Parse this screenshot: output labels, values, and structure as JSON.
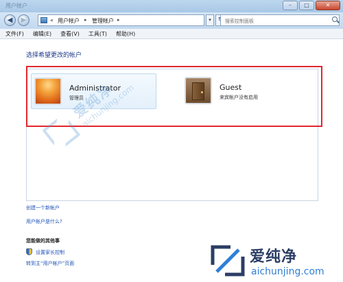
{
  "window": {
    "title": "用户帐户",
    "minimize_glyph": "–",
    "maximize_glyph": "□",
    "close_glyph": "✕"
  },
  "navigation": {
    "back_glyph": "◀",
    "forward_glyph": "▶",
    "address_icon": "control-panel-icon",
    "address_chevron": "«",
    "breadcrumbs": [
      {
        "label": "用户帐户"
      },
      {
        "label": "管理帐户"
      }
    ],
    "breadcrumb_separator": "▸",
    "dropdown_glyph": "▾",
    "refresh_glyph": "↻",
    "search_placeholder": "搜索控制面板"
  },
  "menu": {
    "items": [
      {
        "label": "文件(F)"
      },
      {
        "label": "编辑(E)"
      },
      {
        "label": "查看(V)"
      },
      {
        "label": "工具(T)"
      },
      {
        "label": "帮助(H)"
      }
    ]
  },
  "main": {
    "title": "选择希望更改的帐户",
    "accounts": [
      {
        "name": "Administrator",
        "role": "管理员",
        "icon": "flower-avatar-icon"
      },
      {
        "name": "Guest",
        "role": "来宾帐户没有启用",
        "icon": "guest-door-icon"
      }
    ],
    "links": {
      "create_account": "创建一个新帐户",
      "what_is_account": "用户帐户是什么?"
    }
  },
  "side_tasks": {
    "heading": "您能做的其他事",
    "parental_controls": "设置家长控制",
    "goto_main": "转到主“用户帐户”页面"
  },
  "watermark": {
    "brand_cn": "爱纯净",
    "brand_en": "aichunjing.com"
  },
  "colors": {
    "highlight": "#e2262e",
    "link": "#1e52b8",
    "title_blue": "#1e3a8a"
  }
}
